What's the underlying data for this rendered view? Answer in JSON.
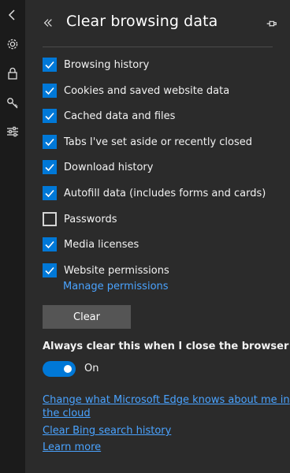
{
  "panel": {
    "title": "Clear browsing data"
  },
  "rail": {
    "icons": [
      "chevron-left-icon",
      "gear-icon",
      "lock-icon",
      "key-icon",
      "sliders-icon"
    ]
  },
  "options": [
    {
      "label": "Browsing history",
      "checked": true
    },
    {
      "label": "Cookies and saved website data",
      "checked": true
    },
    {
      "label": "Cached data and files",
      "checked": true
    },
    {
      "label": "Tabs I've set aside or recently closed",
      "checked": true
    },
    {
      "label": "Download history",
      "checked": true
    },
    {
      "label": "Autofill data (includes forms and cards)",
      "checked": true
    },
    {
      "label": "Passwords",
      "checked": false
    },
    {
      "label": "Media licenses",
      "checked": true
    },
    {
      "label": "Website permissions",
      "checked": true
    }
  ],
  "manage_permissions": "Manage permissions",
  "clear_button": "Clear",
  "always_clear": {
    "label": "Always clear this when I close the browser",
    "toggle_on": true,
    "state_text": "On"
  },
  "links": {
    "edge_knows_line1": "Change what Microsoft Edge knows about me in",
    "edge_knows_line2": "the cloud",
    "bing_history": "Clear Bing search history",
    "learn_more": "Learn more"
  },
  "colors": {
    "accent": "#0078d7",
    "link": "#4aa3ff",
    "panel_bg": "#2b2b2b",
    "rail_bg": "#1b1b1b"
  }
}
